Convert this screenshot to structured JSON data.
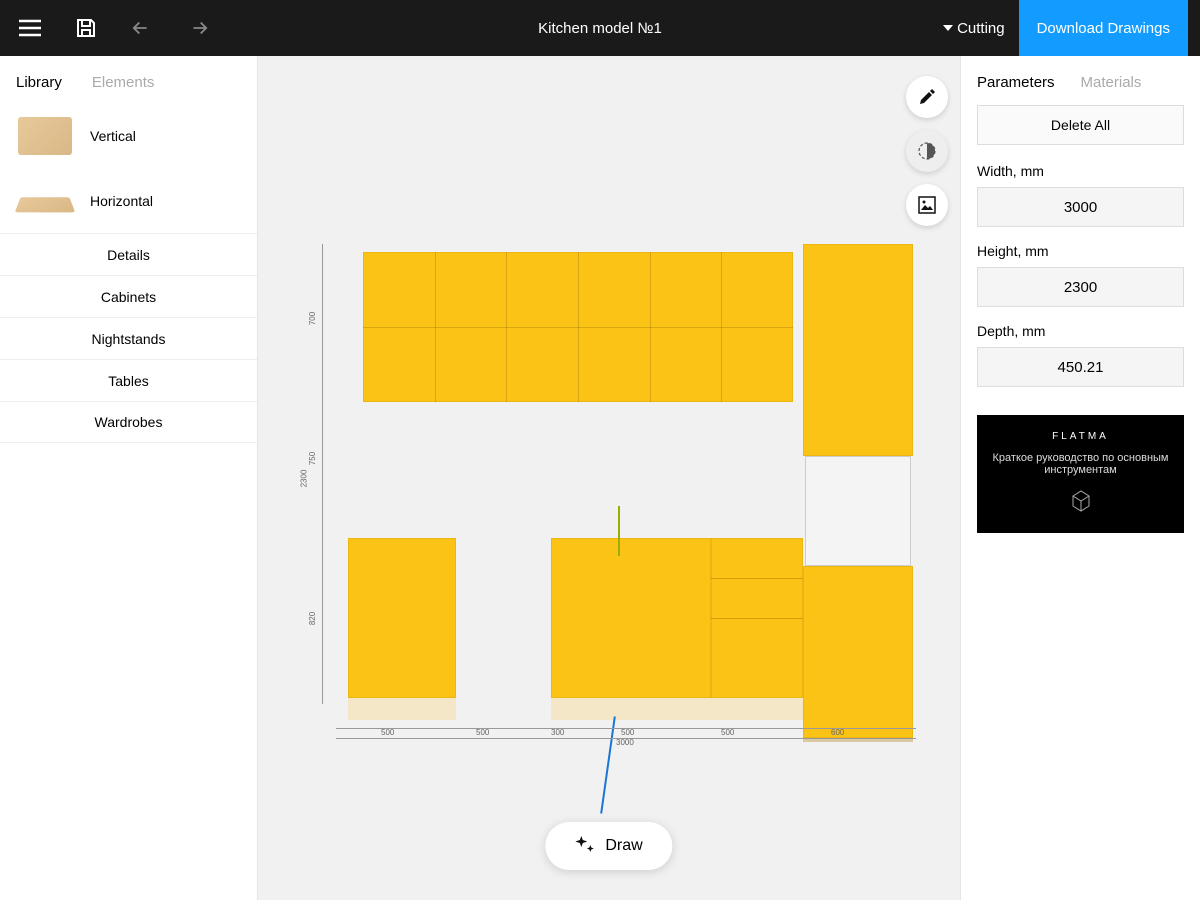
{
  "header": {
    "title": "Kitchen model №1",
    "cutting_label": "Cutting",
    "download_label": "Download Drawings"
  },
  "sidebar": {
    "tabs": {
      "library": "Library",
      "elements": "Elements"
    },
    "library_items": [
      {
        "label": "Vertical"
      },
      {
        "label": "Horizontal"
      }
    ],
    "categories": [
      "Details",
      "Cabinets",
      "Nightstands",
      "Tables",
      "Wardrobes"
    ]
  },
  "canvas": {
    "draw_label": "Draw",
    "dimensions": {
      "total_width": "3000",
      "total_height": "2300",
      "segments_bottom": [
        "500",
        "500",
        "300",
        "500",
        "500",
        "600"
      ],
      "segments_left": [
        "700",
        "750",
        "820"
      ]
    }
  },
  "params": {
    "tabs": {
      "parameters": "Parameters",
      "materials": "Materials"
    },
    "delete_all": "Delete All",
    "width_label": "Width, mm",
    "width_value": "3000",
    "height_label": "Height, mm",
    "height_value": "2300",
    "depth_label": "Depth, mm",
    "depth_value": "450.21"
  },
  "promo": {
    "brand": "FLATMA",
    "text": "Краткое руководство по основным инструментам"
  },
  "colors": {
    "cabinet": "#fbc316",
    "accent": "#139cff"
  }
}
